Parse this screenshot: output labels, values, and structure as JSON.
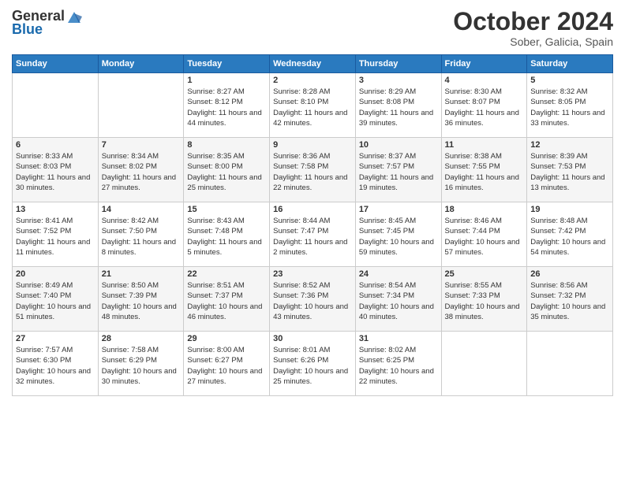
{
  "header": {
    "logo_general": "General",
    "logo_blue": "Blue",
    "month_year": "October 2024",
    "location": "Sober, Galicia, Spain"
  },
  "columns": [
    "Sunday",
    "Monday",
    "Tuesday",
    "Wednesday",
    "Thursday",
    "Friday",
    "Saturday"
  ],
  "rows": [
    [
      {
        "day": "",
        "info": ""
      },
      {
        "day": "",
        "info": ""
      },
      {
        "day": "1",
        "info": "Sunrise: 8:27 AM\nSunset: 8:12 PM\nDaylight: 11 hours and 44 minutes."
      },
      {
        "day": "2",
        "info": "Sunrise: 8:28 AM\nSunset: 8:10 PM\nDaylight: 11 hours and 42 minutes."
      },
      {
        "day": "3",
        "info": "Sunrise: 8:29 AM\nSunset: 8:08 PM\nDaylight: 11 hours and 39 minutes."
      },
      {
        "day": "4",
        "info": "Sunrise: 8:30 AM\nSunset: 8:07 PM\nDaylight: 11 hours and 36 minutes."
      },
      {
        "day": "5",
        "info": "Sunrise: 8:32 AM\nSunset: 8:05 PM\nDaylight: 11 hours and 33 minutes."
      }
    ],
    [
      {
        "day": "6",
        "info": "Sunrise: 8:33 AM\nSunset: 8:03 PM\nDaylight: 11 hours and 30 minutes."
      },
      {
        "day": "7",
        "info": "Sunrise: 8:34 AM\nSunset: 8:02 PM\nDaylight: 11 hours and 27 minutes."
      },
      {
        "day": "8",
        "info": "Sunrise: 8:35 AM\nSunset: 8:00 PM\nDaylight: 11 hours and 25 minutes."
      },
      {
        "day": "9",
        "info": "Sunrise: 8:36 AM\nSunset: 7:58 PM\nDaylight: 11 hours and 22 minutes."
      },
      {
        "day": "10",
        "info": "Sunrise: 8:37 AM\nSunset: 7:57 PM\nDaylight: 11 hours and 19 minutes."
      },
      {
        "day": "11",
        "info": "Sunrise: 8:38 AM\nSunset: 7:55 PM\nDaylight: 11 hours and 16 minutes."
      },
      {
        "day": "12",
        "info": "Sunrise: 8:39 AM\nSunset: 7:53 PM\nDaylight: 11 hours and 13 minutes."
      }
    ],
    [
      {
        "day": "13",
        "info": "Sunrise: 8:41 AM\nSunset: 7:52 PM\nDaylight: 11 hours and 11 minutes."
      },
      {
        "day": "14",
        "info": "Sunrise: 8:42 AM\nSunset: 7:50 PM\nDaylight: 11 hours and 8 minutes."
      },
      {
        "day": "15",
        "info": "Sunrise: 8:43 AM\nSunset: 7:48 PM\nDaylight: 11 hours and 5 minutes."
      },
      {
        "day": "16",
        "info": "Sunrise: 8:44 AM\nSunset: 7:47 PM\nDaylight: 11 hours and 2 minutes."
      },
      {
        "day": "17",
        "info": "Sunrise: 8:45 AM\nSunset: 7:45 PM\nDaylight: 10 hours and 59 minutes."
      },
      {
        "day": "18",
        "info": "Sunrise: 8:46 AM\nSunset: 7:44 PM\nDaylight: 10 hours and 57 minutes."
      },
      {
        "day": "19",
        "info": "Sunrise: 8:48 AM\nSunset: 7:42 PM\nDaylight: 10 hours and 54 minutes."
      }
    ],
    [
      {
        "day": "20",
        "info": "Sunrise: 8:49 AM\nSunset: 7:40 PM\nDaylight: 10 hours and 51 minutes."
      },
      {
        "day": "21",
        "info": "Sunrise: 8:50 AM\nSunset: 7:39 PM\nDaylight: 10 hours and 48 minutes."
      },
      {
        "day": "22",
        "info": "Sunrise: 8:51 AM\nSunset: 7:37 PM\nDaylight: 10 hours and 46 minutes."
      },
      {
        "day": "23",
        "info": "Sunrise: 8:52 AM\nSunset: 7:36 PM\nDaylight: 10 hours and 43 minutes."
      },
      {
        "day": "24",
        "info": "Sunrise: 8:54 AM\nSunset: 7:34 PM\nDaylight: 10 hours and 40 minutes."
      },
      {
        "day": "25",
        "info": "Sunrise: 8:55 AM\nSunset: 7:33 PM\nDaylight: 10 hours and 38 minutes."
      },
      {
        "day": "26",
        "info": "Sunrise: 8:56 AM\nSunset: 7:32 PM\nDaylight: 10 hours and 35 minutes."
      }
    ],
    [
      {
        "day": "27",
        "info": "Sunrise: 7:57 AM\nSunset: 6:30 PM\nDaylight: 10 hours and 32 minutes."
      },
      {
        "day": "28",
        "info": "Sunrise: 7:58 AM\nSunset: 6:29 PM\nDaylight: 10 hours and 30 minutes."
      },
      {
        "day": "29",
        "info": "Sunrise: 8:00 AM\nSunset: 6:27 PM\nDaylight: 10 hours and 27 minutes."
      },
      {
        "day": "30",
        "info": "Sunrise: 8:01 AM\nSunset: 6:26 PM\nDaylight: 10 hours and 25 minutes."
      },
      {
        "day": "31",
        "info": "Sunrise: 8:02 AM\nSunset: 6:25 PM\nDaylight: 10 hours and 22 minutes."
      },
      {
        "day": "",
        "info": ""
      },
      {
        "day": "",
        "info": ""
      }
    ]
  ]
}
